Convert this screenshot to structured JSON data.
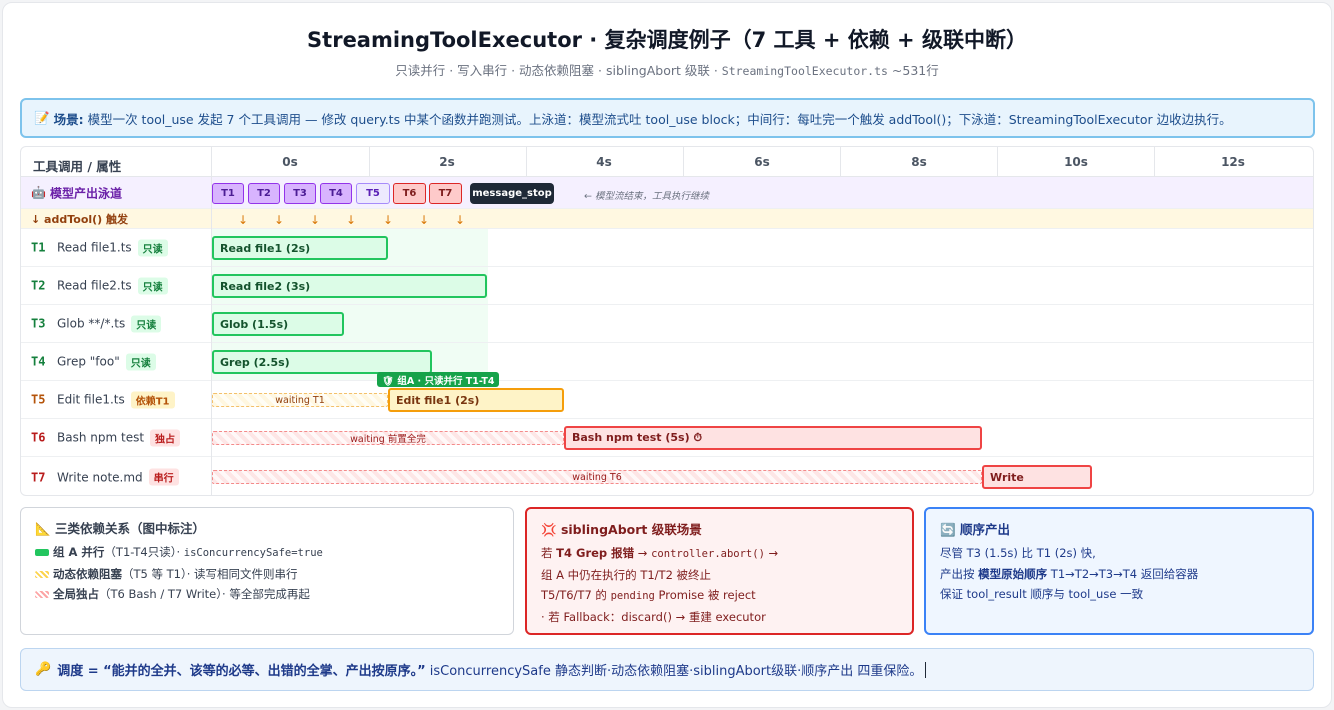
{
  "title": "StreamingToolExecutor · 复杂调度例子（7 工具 + 依赖 + 级联中断）",
  "subtitle": {
    "text": "只读并行 · 写入串行 · 动态依赖阻塞 · siblingAbort 级联 · ",
    "file": "StreamingToolExecutor.ts",
    "lines": " ~531行"
  },
  "scenario": {
    "icon": "📝",
    "label": "场景:",
    "text": "模型一次 tool_use 发起 7 个工具调用 — 修改 query.ts 中某个函数并跑测试。上泳道：模型流式吐 tool_use block；中间行：每吐完一个触发 addTool()；下泳道：StreamingToolExecutor 边收边执行。"
  },
  "timeline": {
    "header_label": "工具调用 / 属性",
    "ticks": [
      "0s",
      "2s",
      "4s",
      "6s",
      "8s",
      "10s",
      "12s"
    ],
    "stream_label": "模型产出泳道",
    "stream_icon": "🤖",
    "stream_chips": [
      "T1",
      "T2",
      "T3",
      "T4",
      "T5",
      "T6",
      "T7"
    ],
    "message_stop": "message_stop",
    "stream_note": "← 模型流结束，工具执行继续",
    "trigger_label": "↓ addTool() 触发",
    "trigger_arrow": "↓",
    "group_tag": "🛡 组A · 只读并行 T1-T4",
    "tools": [
      {
        "id": "T1",
        "name": "Read file1.ts",
        "badge": "只读",
        "bar": "Read file1 (2s)",
        "wait": ""
      },
      {
        "id": "T2",
        "name": "Read file2.ts",
        "badge": "只读",
        "bar": "Read file2 (3s)",
        "wait": ""
      },
      {
        "id": "T3",
        "name": "Glob **/*.ts",
        "badge": "只读",
        "bar": "Glob (1.5s)",
        "wait": ""
      },
      {
        "id": "T4",
        "name": "Grep \"foo\"",
        "badge": "只读",
        "bar": "Grep (2.5s)",
        "wait": ""
      },
      {
        "id": "T5",
        "name": "Edit file1.ts",
        "badge": "依赖T1",
        "bar": "Edit file1 (2s)",
        "wait": "waiting T1"
      },
      {
        "id": "T6",
        "name": "Bash npm test",
        "badge": "独占",
        "bar": "Bash npm test (5s) ⏱",
        "wait": "waiting 前置全完"
      },
      {
        "id": "T7",
        "name": "Write note.md",
        "badge": "串行",
        "bar": "Write",
        "wait": "waiting T6"
      }
    ]
  },
  "box_deps": {
    "icon": "📐",
    "title": "三类依赖关系（图中标注）",
    "l1_bold": "组 A 并行",
    "l1_rest": "（T1-T4只读）· ",
    "l1_mono": "isConcurrencySafe=true",
    "l2_bold": "动态依赖阻塞",
    "l2_rest": "（T5 等 T1）· 读写相同文件则串行",
    "l3_bold": "全局独占",
    "l3_rest": "（T6 Bash / T7 Write）· 等全部完成再起"
  },
  "box_abort": {
    "icon": "💢",
    "title": "siblingAbort 级联场景",
    "l1_pre": "若 ",
    "l1_bold": "T4 Grep 报错",
    "l1_arrow": " → ",
    "l1_mono": "controller.abort()",
    "l1_tail": " →",
    "l2": "组 A 中仍在执行的 T1/T2 被终止",
    "l3_pre": "T5/T6/T7 的 ",
    "l3_mono": "pending",
    "l3_tail": " Promise 被 reject",
    "l4": "· 若 Fallback：discard() → 重建 executor"
  },
  "box_order": {
    "icon": "🔄",
    "title": "顺序产出",
    "l1": "尽管 T3 (1.5s) 比 T1 (2s) 快,",
    "l2_pre": "产出按 ",
    "l2_bold": "模型原始顺序",
    "l2_tail": " T1→T2→T3→T4 返回给容器",
    "l3": "保证 tool_result 顺序与 tool_use 一致"
  },
  "footer": {
    "icon": "🔑",
    "bold": "调度 = “能并的全并、该等的必等、出错的全掌、产出按原序。”",
    "rest": "isConcurrencySafe 静态判断·动态依赖阻塞·siblingAbort级联·顺序产出 四重保险。"
  },
  "colors": {
    "readonly": "#22c55e",
    "dependent": "#f59e0b",
    "exclusive": "#ef4444",
    "stream": "#9333ea",
    "accent": "#3b82f6"
  }
}
